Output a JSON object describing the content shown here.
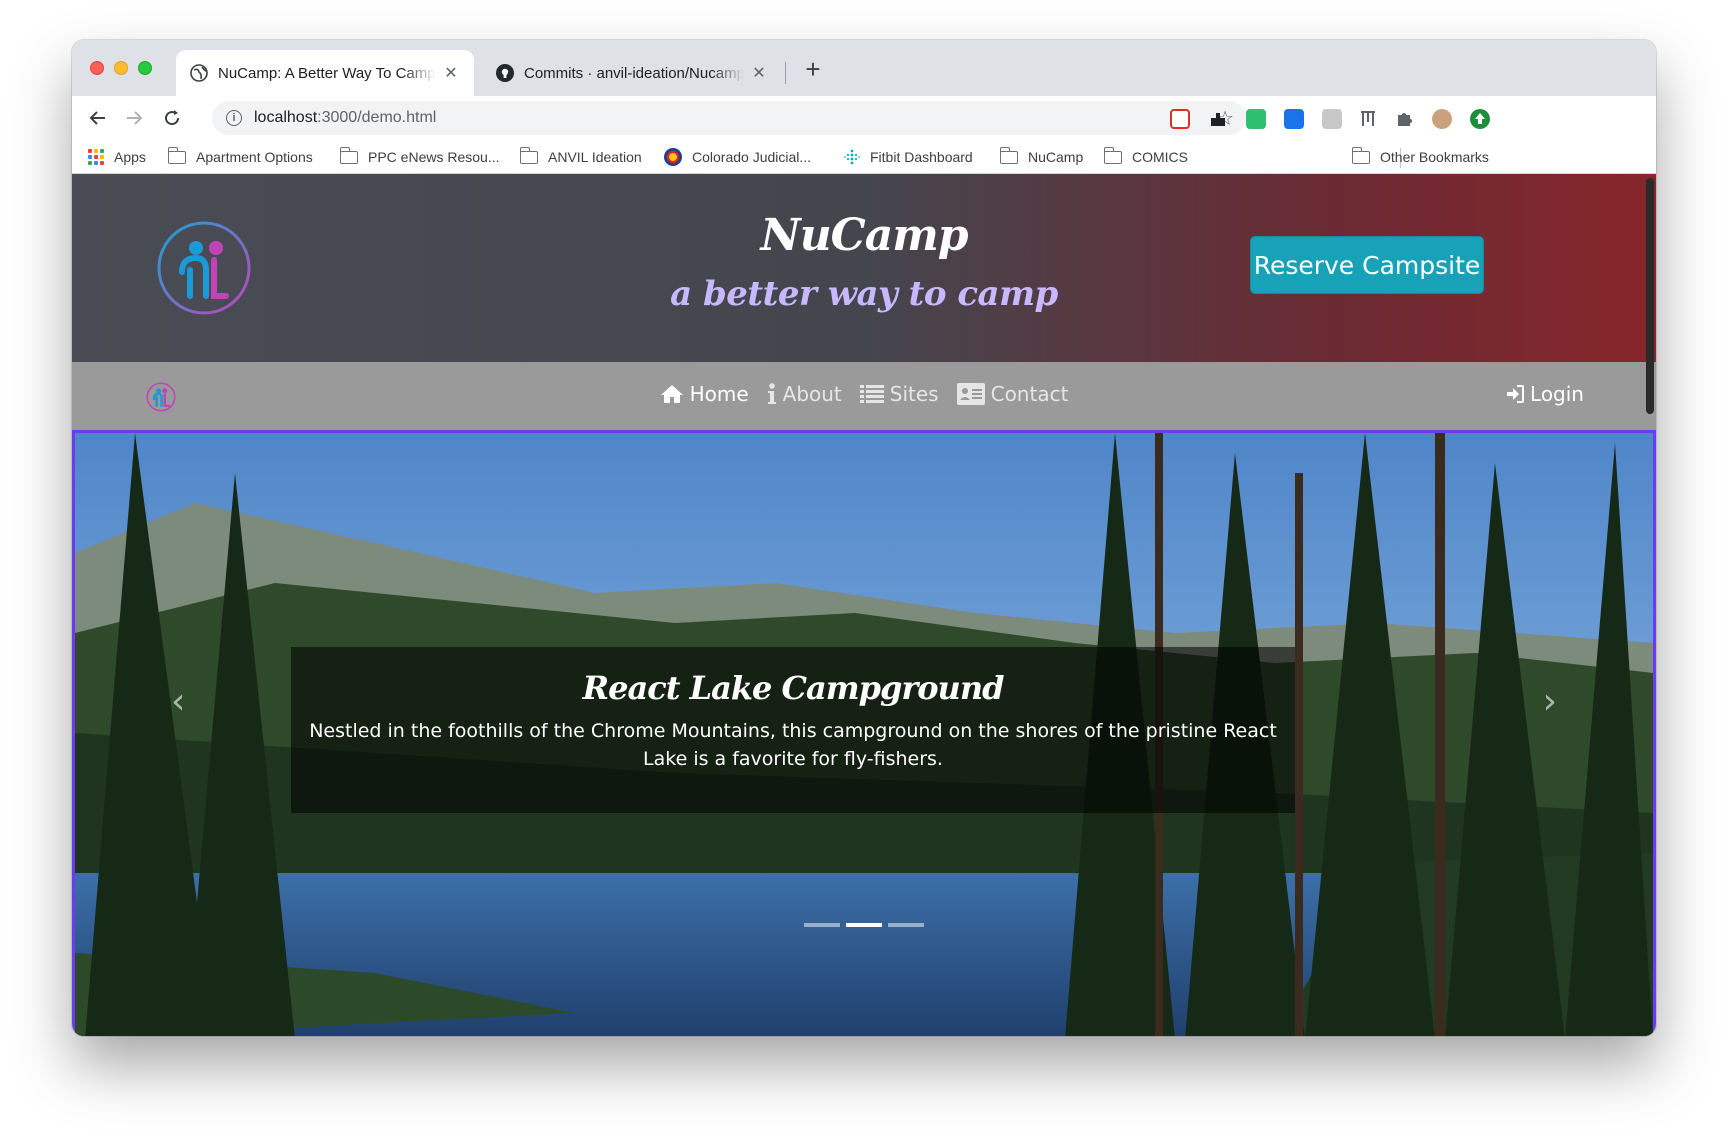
{
  "browser": {
    "tabs": [
      {
        "title": "NuCamp: A Better Way To Camp",
        "close": "✕",
        "active": true
      },
      {
        "title": "Commits · anvil-ideation/Nucamp",
        "close": "✕",
        "active": false
      }
    ],
    "new_tab": "+",
    "url_host": "localhost",
    "url_rest": ":3000/demo.html",
    "bookmarks": [
      {
        "label": "Apps",
        "icon": "apps-grid-icon"
      },
      {
        "label": "Apartment Options",
        "icon": "folder-icon"
      },
      {
        "label": "PPC eNews Resou...",
        "icon": "folder-icon"
      },
      {
        "label": "ANVIL Ideation",
        "icon": "folder-icon"
      },
      {
        "label": "Colorado Judicial...",
        "icon": "colorado-icon"
      },
      {
        "label": "Fitbit Dashboard",
        "icon": "fitbit-icon"
      },
      {
        "label": "NuCamp",
        "icon": "folder-icon"
      },
      {
        "label": "COMICS",
        "icon": "folder-icon"
      }
    ],
    "other_bookmarks": "Other Bookmarks"
  },
  "site": {
    "brand": "NuCamp",
    "tagline": "a better way to camp",
    "reserve_label": "Reserve Campsite",
    "nav": {
      "home": "Home",
      "about": "About",
      "sites": "Sites",
      "contact": "Contact",
      "login": "Login"
    },
    "carousel": {
      "title": "React Lake Campground",
      "text": "Nestled in the foothills of the Chrome Mountains, this campground on the shores of the pristine React Lake is a favorite for fly-fishers.",
      "prev": "‹",
      "next": "›",
      "slide_count": 3,
      "active_slide": 2
    }
  },
  "colors": {
    "reserve_button": "#17a2b8",
    "carousel_border": "#6a3cf0",
    "tagline": "#c7b8ff",
    "navbar": "#9a9a9a"
  }
}
